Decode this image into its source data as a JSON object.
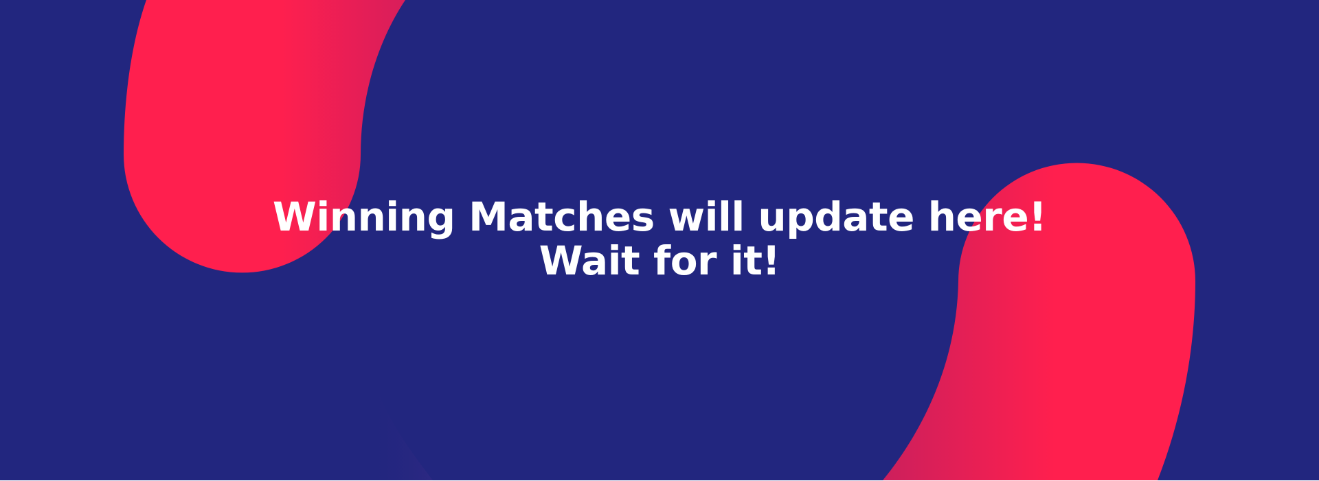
{
  "banner": {
    "headline_line1": "Winning Matches will update here!",
    "headline_line2": "Wait for it!"
  },
  "colors": {
    "background": "#22267f",
    "accent": "#ff1f4e",
    "accent_shadow": "#cc1f5c",
    "text": "#ffffff"
  }
}
